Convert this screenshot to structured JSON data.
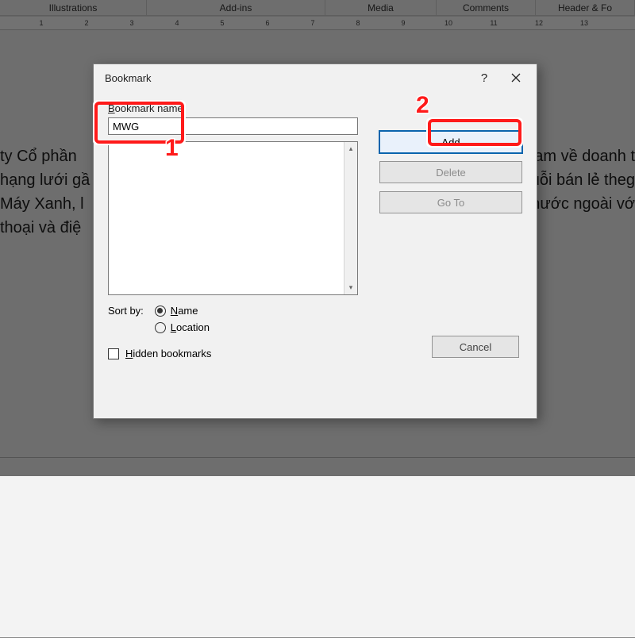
{
  "ribbon": {
    "groups": [
      "Illustrations",
      "Add-ins",
      "Media",
      "Comments",
      "Header & Fo"
    ]
  },
  "ruler": {
    "majors": [
      "1",
      "2",
      "3",
      "4",
      "5",
      "6",
      "7",
      "8",
      "9",
      "10",
      "11",
      "12",
      "13"
    ]
  },
  "document": {
    "line1_left": "ty Cổ phần",
    "line1_right": "am về doanh t",
    "line2_left": "hạng lưới gầ",
    "line2_right": "uỗi bán lẻ theg",
    "line3_left": "Máy Xanh, l",
    "line3_right": "nước ngoài vớ",
    "line4_left": "thoại và điệ"
  },
  "dialog": {
    "title": "Bookmark",
    "help": "?",
    "name_label": "Bookmark name:",
    "name_value": "MWG",
    "buttons": {
      "add": "Add",
      "delete": "Delete",
      "goto": "Go To",
      "cancel": "Cancel"
    },
    "sort_label": "Sort by:",
    "sort_name": "Name",
    "sort_location": "Location",
    "hidden": "Hidden bookmarks"
  },
  "annotations": {
    "n1": "1",
    "n2": "2"
  }
}
